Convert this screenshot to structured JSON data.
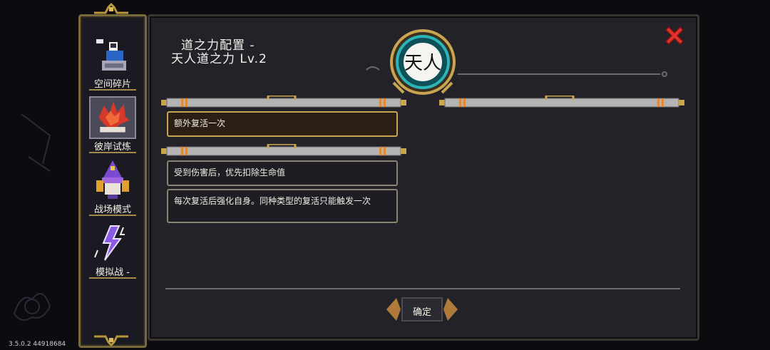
{
  "sidebar": {
    "items": [
      {
        "label": "空间碎片",
        "active": false,
        "icon": "space-fragment-icon"
      },
      {
        "label": "彼岸试炼",
        "active": true,
        "icon": "trial-flower-icon"
      },
      {
        "label": "战场模式",
        "active": false,
        "icon": "wizard-icon"
      },
      {
        "label": "模拟战 -",
        "active": false,
        "icon": "lightning-icon"
      }
    ]
  },
  "panel": {
    "title_line1": "道之力配置 -",
    "title_line2": "天人道之力 Lv.2",
    "emblem_glyph": "天人",
    "close_icon": "close-x-icon",
    "cards": [
      {
        "text": "额外复活一次",
        "selected": true
      },
      {
        "text": "受到伤害后，优先扣除生命值",
        "selected": false
      },
      {
        "text": "每次复活后强化自身。同种类型的复活只能触发一次",
        "selected": false
      }
    ],
    "confirm_label": "确定"
  },
  "version": "3.5.0.2 44918684",
  "colors": {
    "accent_gold": "#c9a451",
    "close_red": "#e0312a",
    "emblem_teal": "#2bb5b8"
  }
}
